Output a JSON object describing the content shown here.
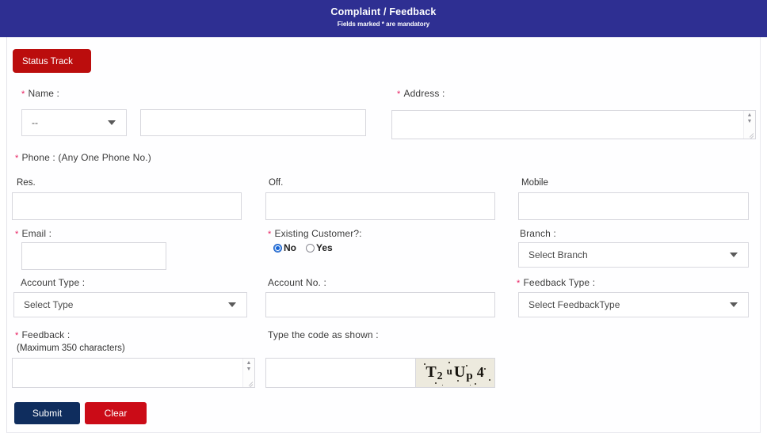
{
  "header": {
    "title": "Complaint / Feedback",
    "subtitle": "Fields marked * are mandatory",
    "bg_color": "#2e2f92"
  },
  "toolbar": {
    "status_track_label": "Status Track",
    "status_track_color": "#bb0d0d"
  },
  "form": {
    "asterisk": "*",
    "name": {
      "label": "Name :",
      "title_select_value": "--",
      "name_input_value": "",
      "name_input_placeholder": ""
    },
    "address": {
      "label": "Address :",
      "value": "",
      "placeholder": ""
    },
    "phone": {
      "label": "Phone : (Any One Phone No.)",
      "res_label": "Res.",
      "res_value": "",
      "off_label": "Off.",
      "off_value": "",
      "mobile_label": "Mobile",
      "mobile_value": ""
    },
    "email": {
      "label": "Email :",
      "value": "",
      "placeholder": ""
    },
    "existing_customer": {
      "label": "Existing Customer?:",
      "options": [
        {
          "label": "No",
          "selected": true
        },
        {
          "label": "Yes",
          "selected": false
        }
      ],
      "selected_value": "No",
      "selected_color": "#1565d8"
    },
    "branch": {
      "label": "Branch :",
      "selected": "Select Branch"
    },
    "account_type": {
      "label": "Account Type :",
      "selected": "Select Type"
    },
    "account_no": {
      "label": "Account No. :",
      "value": ""
    },
    "feedback_type": {
      "label": "Feedback Type :",
      "selected": "Select FeedbackType"
    },
    "feedback": {
      "label": "Feedback :",
      "hint": "(Maximum 350 characters)",
      "value": "",
      "max_characters": 350
    },
    "captcha": {
      "label": "Type the code as shown :",
      "input_value": "",
      "code_text": "T2uUp4",
      "code_chars": [
        "T",
        "2",
        "u",
        "U",
        "p",
        "4"
      ],
      "background_color": "#edeade"
    }
  },
  "actions": {
    "submit_label": "Submit",
    "submit_color": "#0f2d5e",
    "clear_label": "Clear",
    "clear_color": "#cb0b17"
  },
  "icons": {
    "caret": "chevron-down-icon",
    "scroll_up": "▲",
    "scroll_down": "▼"
  }
}
